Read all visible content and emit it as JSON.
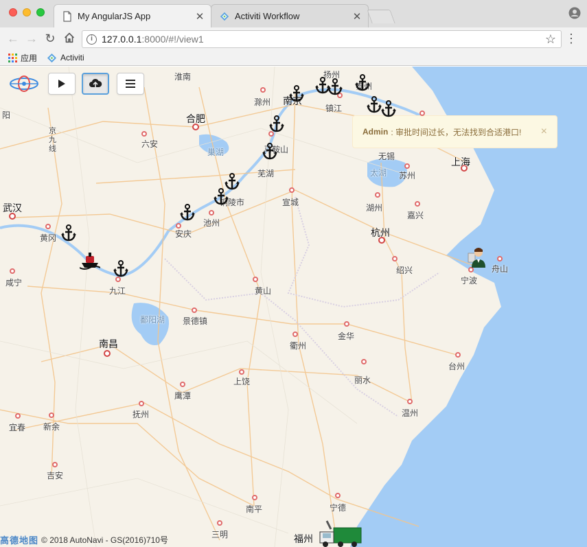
{
  "browser": {
    "tabs": [
      {
        "title": "My AngularJS App",
        "active": true
      },
      {
        "title": "Activiti Workflow",
        "active": false
      }
    ],
    "url_host": "127.0.0.1",
    "url_rest": ":8000/#!/view1",
    "bookmarks": [
      {
        "label": "应用",
        "icon": "apps-grid-icon"
      },
      {
        "label": "Activiti",
        "icon": "activiti-diamond-icon"
      }
    ]
  },
  "map_controls": {
    "play": "play-icon",
    "upload": "cloud-upload-icon",
    "menu": "hamburger-menu-icon"
  },
  "alert": {
    "user": "Admin",
    "message": ": 审批时间过长，无法找到合适港口!",
    "close": "×"
  },
  "attribution": {
    "logo": "高德地图",
    "text": "© 2018 AutoNavi - GS(2016)710号"
  },
  "cities": {
    "huaiNan": "淮南",
    "yangzhou": "扬州",
    "taizhou": "泰州",
    "chuzhou": "滁州",
    "nanjing": "南京",
    "zhenjiang": "镇江",
    "hefei": "合肥",
    "luan": "六安",
    "chaohu": "巢湖",
    "maanshan": "马鞍山",
    "wuxi": "无锡",
    "taihu": "太湖",
    "suzhou": "苏州",
    "shanghai": "上海",
    "wuhu": "芜湖",
    "tongling": "铜陵市",
    "xuancheng": "宣城",
    "huzhou": "湖州",
    "jiaxing": "嘉兴",
    "wuhan": "武汉",
    "huanggang": "黄冈",
    "anqing": "安庆",
    "chizhou": "池州",
    "hangzhou": "杭州",
    "shaoxing": "绍兴",
    "ningbo": "宁波",
    "zhoushan": "舟山",
    "xianning": "咸宁",
    "jiujiang": "九江",
    "huangshan": "黄山",
    "poyanghu": "鄱阳湖",
    "jingdezhen": "景德镇",
    "quzhou": "衢州",
    "jinhua": "金华",
    "taizhouzj": "台州",
    "nanchang": "南昌",
    "shangrao": "上饶",
    "lishui": "丽水",
    "yingtan": "鹰潭",
    "fuzhoujx": "抚州",
    "wenzhou": "温州",
    "yichun": "宜春",
    "xinyu": "新余",
    "jian": "吉安",
    "nanping": "南平",
    "ningde": "宁德",
    "sanming": "三明",
    "fuzhou": "福州",
    "jingjiu": "京九线",
    "yang": "阳"
  }
}
